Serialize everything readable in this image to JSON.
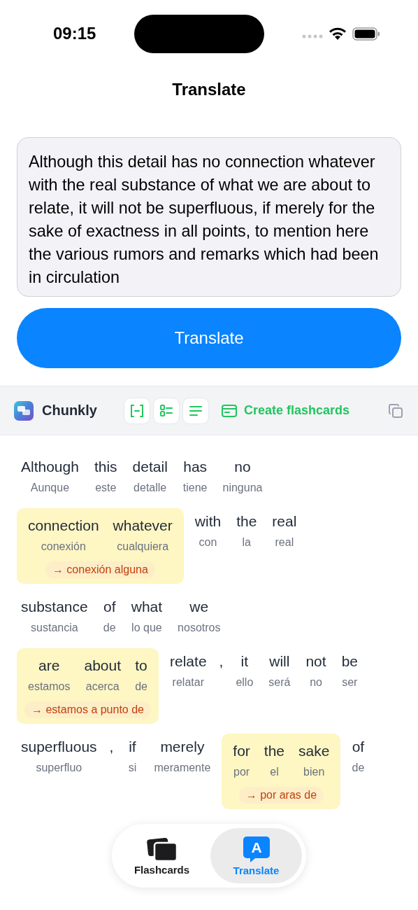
{
  "status_bar": {
    "time": "09:15"
  },
  "title": "Translate",
  "input": {
    "value": "Although this detail has no connection whatever with the real substance of what we are about to relate, it will not be superfluous, if merely for the sake of exactness in all points, to mention here the various rumors and remarks which had been in circulation"
  },
  "translate_button": "Translate",
  "toolbar": {
    "app_name": "Chunkly",
    "view_modes": [
      {
        "kind": "chunks",
        "selected": false
      },
      {
        "kind": "list",
        "selected": false
      },
      {
        "kind": "text",
        "selected": false
      }
    ],
    "create_flashcards": "Create flashcards"
  },
  "chunk_lines": [
    [
      {
        "kind": "word",
        "text": "Although",
        "gloss": "Aunque"
      },
      {
        "kind": "word",
        "text": "this",
        "gloss": "este"
      },
      {
        "kind": "word",
        "text": "detail",
        "gloss": "detalle"
      },
      {
        "kind": "word",
        "text": "has",
        "gloss": "tiene"
      },
      {
        "kind": "word",
        "text": "no",
        "gloss": "ninguna"
      }
    ],
    [
      {
        "kind": "phrase",
        "words": [
          {
            "text": "connection",
            "gloss": "conexión"
          },
          {
            "text": "whatever",
            "gloss": "cualquiera"
          }
        ],
        "translation": "→ conexión alguna"
      },
      {
        "kind": "word",
        "text": "with",
        "gloss": "con"
      },
      {
        "kind": "word",
        "text": "the",
        "gloss": "la"
      },
      {
        "kind": "word",
        "text": "real",
        "gloss": "real"
      }
    ],
    [
      {
        "kind": "word",
        "text": "substance",
        "gloss": "sustancia"
      },
      {
        "kind": "word",
        "text": "of",
        "gloss": "de"
      },
      {
        "kind": "word",
        "text": "what",
        "gloss": "lo que"
      },
      {
        "kind": "word",
        "text": "we",
        "gloss": "nosotros"
      }
    ],
    [
      {
        "kind": "phrase",
        "words": [
          {
            "text": "are",
            "gloss": "estamos"
          },
          {
            "text": "about",
            "gloss": "acerca"
          },
          {
            "text": "to",
            "gloss": "de"
          }
        ],
        "translation": "→ estamos a punto de"
      },
      {
        "kind": "word",
        "text": "relate",
        "gloss": "relatar"
      },
      {
        "kind": "punct",
        "text": ","
      },
      {
        "kind": "word",
        "text": "it",
        "gloss": "ello"
      },
      {
        "kind": "word",
        "text": "will",
        "gloss": "será"
      },
      {
        "kind": "word",
        "text": "not",
        "gloss": "no"
      },
      {
        "kind": "word",
        "text": "be",
        "gloss": "ser"
      }
    ],
    [
      {
        "kind": "word",
        "text": "superfluous",
        "gloss": "superfluo"
      },
      {
        "kind": "punct",
        "text": ","
      },
      {
        "kind": "word",
        "text": "if",
        "gloss": "si"
      },
      {
        "kind": "word",
        "text": "merely",
        "gloss": "meramente"
      },
      {
        "kind": "phrase",
        "words": [
          {
            "text": "for",
            "gloss": "por"
          },
          {
            "text": "the",
            "gloss": "el"
          },
          {
            "text": "sake",
            "gloss": "bien"
          }
        ],
        "translation": "→ por aras de"
      },
      {
        "kind": "word",
        "text": "of",
        "gloss": "de"
      }
    ]
  ],
  "tab_bar": [
    {
      "kind": "cards",
      "label": "Flashcards",
      "selected": false
    },
    {
      "kind": "translate",
      "label": "Translate",
      "icon_text": "A",
      "selected": true
    }
  ]
}
